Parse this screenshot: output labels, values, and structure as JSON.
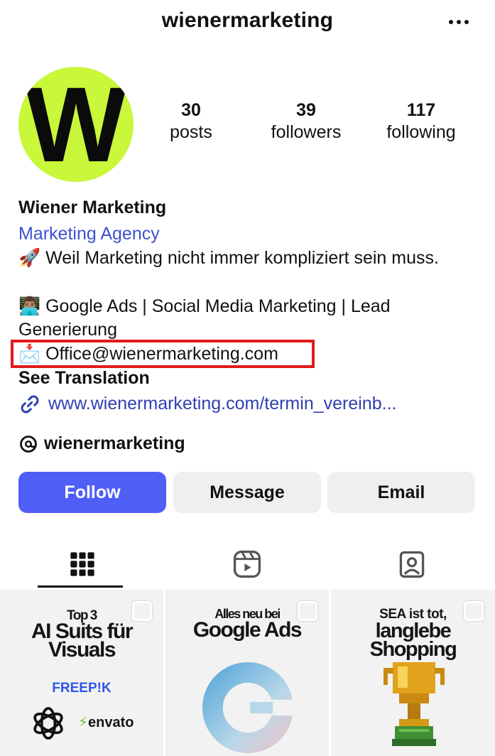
{
  "header": {
    "username": "wienermarketing"
  },
  "profile": {
    "avatar_letter": "W",
    "stats": [
      {
        "value": "30",
        "label": "posts"
      },
      {
        "value": "39",
        "label": "followers"
      },
      {
        "value": "117",
        "label": "following"
      }
    ],
    "name": "Wiener Marketing",
    "category": "Marketing Agency",
    "bio_line1": "Weil Marketing nicht immer kompliziert sein muss.",
    "bio_line2": "Google Ads | Social Media Marketing | Lead Generierung",
    "email": "Office@wienermarketing.com",
    "see_translation": "See Translation",
    "link": "www.wienermarketing.com/termin_vereinb...",
    "threads_handle": "wienermarketing",
    "emoji_rocket": "🚀",
    "emoji_person": "👨🏽‍💻",
    "emoji_envelope": "📩"
  },
  "buttons": {
    "follow": "Follow",
    "message": "Message",
    "email": "Email"
  },
  "colors": {
    "accent": "#4f5ef5",
    "link": "#3f51d1",
    "avatar_bg": "#c9f73a",
    "highlight": "#e11b1b"
  },
  "posts": [
    {
      "line1": "Top 3",
      "line2": "AI Suits für",
      "line3": "Visuals",
      "brand1": "FREEP!K",
      "brand2": "envato"
    },
    {
      "line1": "Alles neu bei",
      "line2": "Google Ads",
      "logo_letter": "G"
    },
    {
      "line1": "SEA ist tot,",
      "line2": "langlebe",
      "line3": "Shopping"
    }
  ]
}
